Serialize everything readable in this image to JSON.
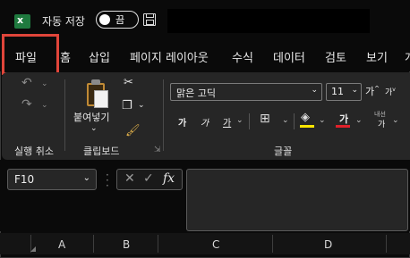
{
  "app": {
    "logo_letter": "x",
    "autosave_label": "자동 저장",
    "autosave_state": "끔"
  },
  "tabs": [
    {
      "label": "파일"
    },
    {
      "label": "홈"
    },
    {
      "label": "삽입"
    },
    {
      "label": "페이지 레이아웃"
    },
    {
      "label": "수식"
    },
    {
      "label": "데이터"
    },
    {
      "label": "검토"
    },
    {
      "label": "보기"
    },
    {
      "label": "개"
    }
  ],
  "ribbon": {
    "paste_label": "붙여넣기",
    "font_name": "맑은 고딕",
    "font_size": "11",
    "groups": {
      "undo": "실행 취소",
      "clipboard": "클립보드",
      "font": "글꼴"
    },
    "font_buttons": {
      "increase": "가",
      "decrease": "가",
      "bold": "가",
      "italic": "가",
      "underline": "가",
      "font_color": "가",
      "phonetic": "내선",
      "phonetic_sub": "가"
    },
    "colors": {
      "highlight": "#ffe600",
      "font_color": "#e0202a"
    }
  },
  "formula_bar": {
    "name_box": "F10",
    "fx": "fx"
  },
  "columns": [
    "A",
    "B",
    "C",
    "D"
  ]
}
